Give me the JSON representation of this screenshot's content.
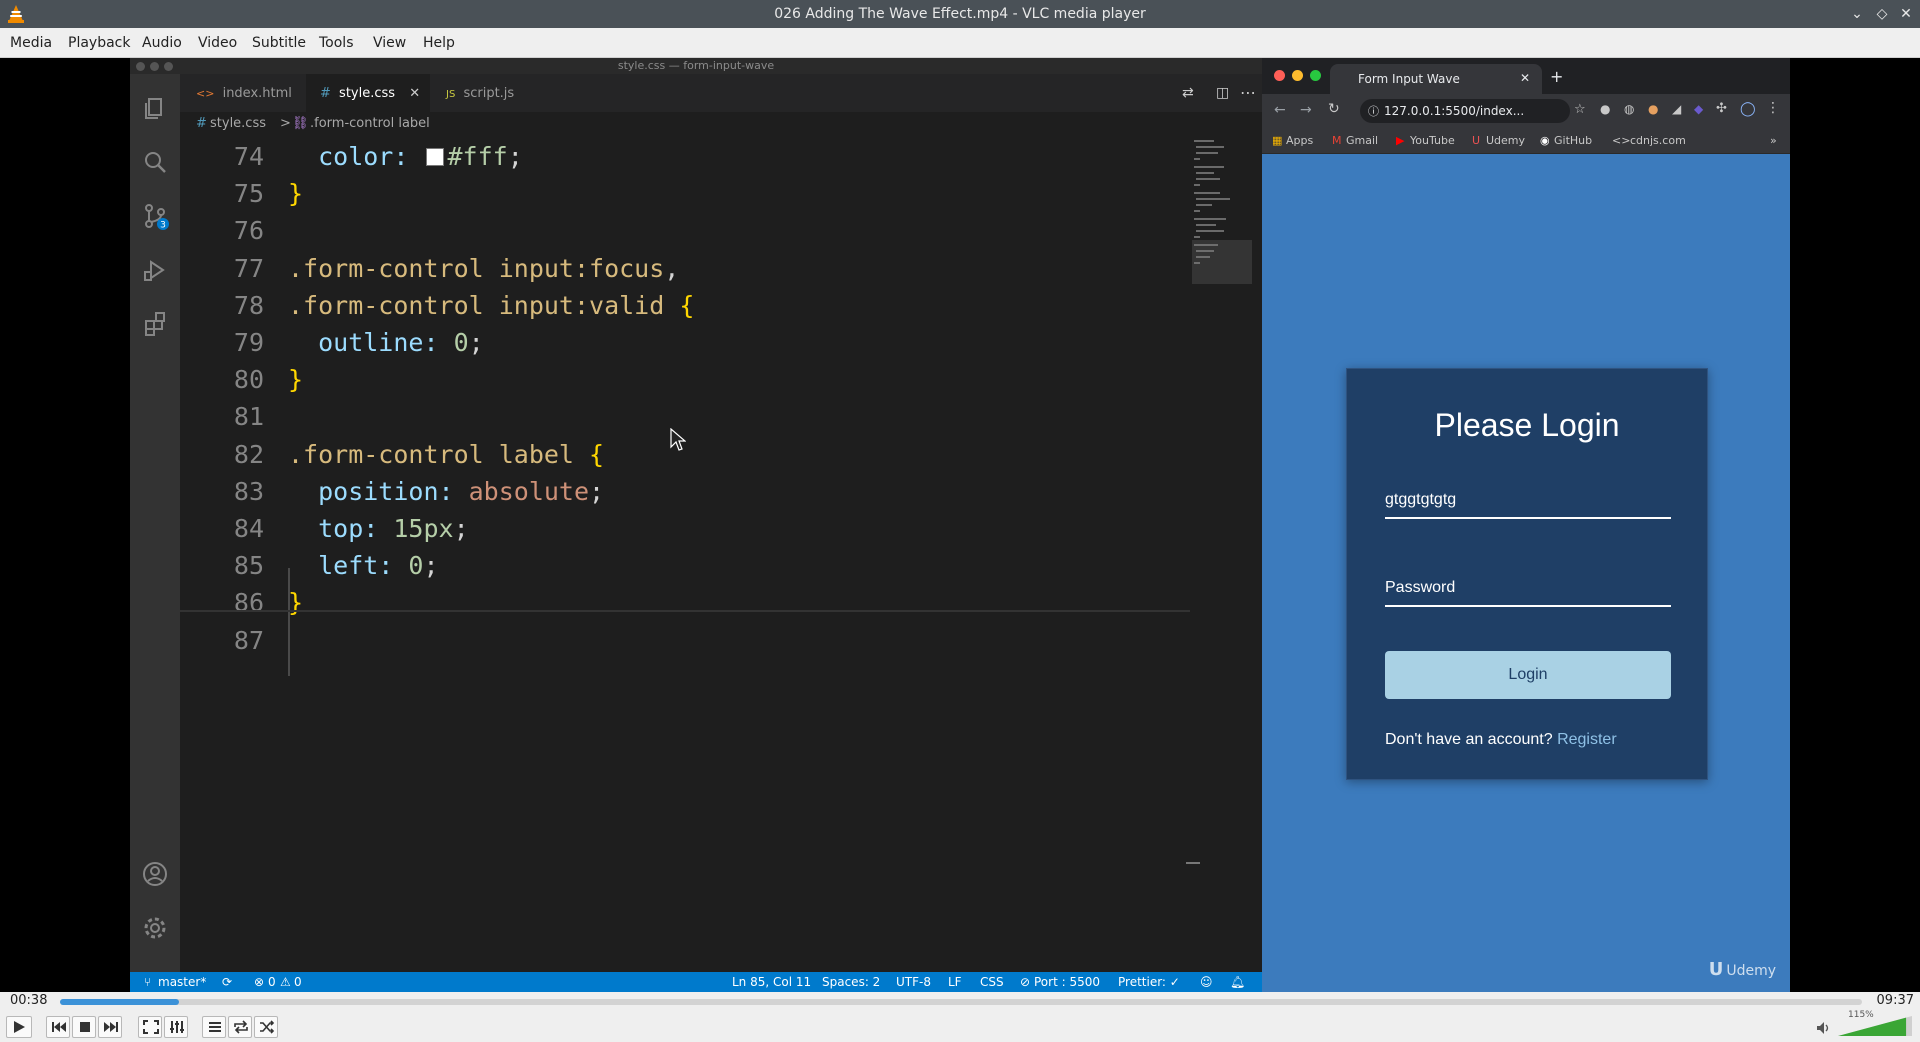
{
  "window": {
    "title": "026 Adding The Wave Effect.mp4 - VLC media player"
  },
  "menu": [
    "Media",
    "Playback",
    "Audio",
    "Video",
    "Subtitle",
    "Tools",
    "View",
    "Help"
  ],
  "vscode": {
    "window_title": "style.css — form-input-wave",
    "tabs": [
      {
        "label": "index.html",
        "icon": "<>"
      },
      {
        "label": "style.css",
        "icon": "#"
      },
      {
        "label": "script.js",
        "icon": "JS"
      }
    ],
    "breadcrumb": {
      "file": "style.css",
      "separator": ">",
      "symbol": ".form-control label"
    },
    "scm_badge": "3",
    "status": {
      "branch": "master*",
      "problems": "0",
      "warnings": "0",
      "position": "Ln 85, Col 11",
      "spaces": "Spaces: 2",
      "encoding": "UTF-8",
      "eol": "LF",
      "language": "CSS",
      "port": "Port : 5500",
      "prettier": "Prettier: ✓"
    },
    "code_lines": [
      {
        "n": "74",
        "parts": [
          [
            "prop",
            "  color: "
          ],
          [
            "swatch",
            ""
          ],
          [
            "num",
            "#fff"
          ],
          [
            "punct",
            ";"
          ]
        ]
      },
      {
        "n": "75",
        "parts": [
          [
            "brace",
            "}"
          ]
        ]
      },
      {
        "n": "76",
        "parts": []
      },
      {
        "n": "77",
        "parts": [
          [
            "sel",
            ".form-control input:focus"
          ],
          [
            "punct",
            ","
          ]
        ]
      },
      {
        "n": "78",
        "parts": [
          [
            "sel",
            ".form-control input:valid "
          ],
          [
            "brace",
            "{"
          ]
        ]
      },
      {
        "n": "79",
        "parts": [
          [
            "prop",
            "  outline: "
          ],
          [
            "num",
            "0"
          ],
          [
            "punct",
            ";"
          ]
        ]
      },
      {
        "n": "80",
        "parts": [
          [
            "brace",
            "}"
          ]
        ]
      },
      {
        "n": "81",
        "parts": []
      },
      {
        "n": "82",
        "parts": [
          [
            "sel",
            ".form-control label "
          ],
          [
            "brace",
            "{"
          ]
        ]
      },
      {
        "n": "83",
        "parts": [
          [
            "prop",
            "  position: "
          ],
          [
            "val",
            "absolute"
          ],
          [
            "punct",
            ";"
          ]
        ]
      },
      {
        "n": "84",
        "parts": [
          [
            "prop",
            "  top: "
          ],
          [
            "num",
            "15px"
          ],
          [
            "punct",
            ";"
          ]
        ]
      },
      {
        "n": "85",
        "parts": [
          [
            "prop",
            "  left: "
          ],
          [
            "num",
            "0"
          ],
          [
            "punct",
            ";"
          ]
        ]
      },
      {
        "n": "86",
        "parts": [
          [
            "brace",
            "}"
          ]
        ]
      },
      {
        "n": "87",
        "parts": []
      }
    ]
  },
  "browser": {
    "tab_title": "Form Input Wave",
    "url": "127.0.0.1:5500/index...",
    "bookmarks": [
      "Apps",
      "Gmail",
      "YouTube",
      "Udemy",
      "GitHub",
      "cdnjs.com"
    ],
    "bookmark_colors": [
      "#f4b400",
      "#ea4335",
      "#ff0000",
      "#ec5252",
      "#ffffff",
      "#aaaaaa"
    ],
    "more": "»",
    "watermark": "Udemy"
  },
  "login": {
    "heading": "Please Login",
    "email_value": "gtggtgtgtg",
    "password_placeholder": "Password",
    "button": "Login",
    "footer_text": "Don't have an account? ",
    "footer_link": "Register"
  },
  "player": {
    "current_time": "00:38",
    "total_time": "09:37",
    "progress": 0.066,
    "volume_label": "115%",
    "volume": 1.15,
    "accent": "#3c92d8"
  }
}
